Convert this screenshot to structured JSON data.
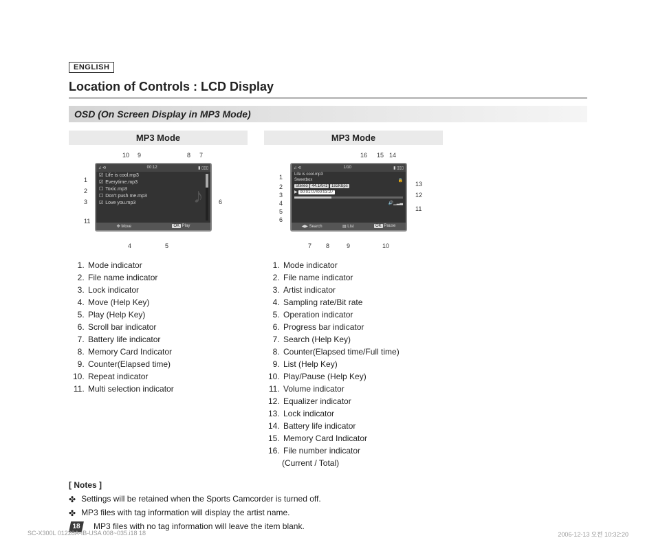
{
  "language_tag": "ENGLISH",
  "title": "Location of Controls : LCD Display",
  "subtitle": "OSD (On Screen Display in MP3 Mode)",
  "left": {
    "heading": "MP3 Mode",
    "lcd": {
      "counter": "00:12",
      "files": [
        "Life is cool.mp3",
        "Everytime.mp3",
        "Toxic.mp3",
        "Don't push me.mp3",
        "Love you.mp3"
      ],
      "help_move": "Move",
      "help_play": "Play",
      "help_play_key": "OK"
    },
    "callouts": [
      "1",
      "2",
      "3",
      "4",
      "5",
      "6",
      "7",
      "8",
      "9",
      "10",
      "11"
    ],
    "items": [
      "Mode indicator",
      "File name indicator",
      "Lock indicator",
      "Move (Help Key)",
      "Play (Help Key)",
      "Scroll bar indicator",
      "Battery life indicator",
      "Memory Card Indicator",
      "Counter(Elapsed time)",
      "Repeat indicator",
      "Multi selection indicator"
    ]
  },
  "right": {
    "heading": "MP3 Mode",
    "lcd": {
      "file_num": "1/10",
      "file": "Life is cool.mp3",
      "artist": "Sweetbox",
      "stereo": "Stereo",
      "rate": "44.1KHz",
      "bitrate": "192Kbps",
      "time": "00:01:07/00:03:27",
      "help_search": "Search",
      "help_list": "List",
      "help_pause": "Pause",
      "help_pause_key": "OK"
    },
    "callouts": [
      "1",
      "2",
      "3",
      "4",
      "5",
      "6",
      "7",
      "8",
      "9",
      "10",
      "11",
      "12",
      "13",
      "14",
      "15",
      "16"
    ],
    "items": [
      "Mode indicator",
      "File name indicator",
      "Artist indicator",
      "Sampling rate/Bit rate",
      "Operation indicator",
      "Progress bar indicator",
      "Search (Help Key)",
      "Counter(Elapsed time/Full time)",
      "List (Help Key)",
      "Play/Pause (Help Key)",
      "Volume indicator",
      "Equalizer indicator",
      "Lock indicator",
      "Battery life indicator",
      "Memory Card Indicator",
      "File number indicator"
    ],
    "item16_sub": "(Current / Total)"
  },
  "notes": {
    "title": "[ Notes ]",
    "lines": [
      "Settings will be retained when the Sports Camcorder is turned off.",
      "MP3 files with tag information will display the artist name.",
      "MP3 files with no tag information will leave the item blank."
    ],
    "page_num": "18"
  },
  "footer": {
    "left": "SC-X300L 01228A-IB-USA 008~035.i18   18",
    "right": "2006-12-13   오전 10:32:20"
  }
}
